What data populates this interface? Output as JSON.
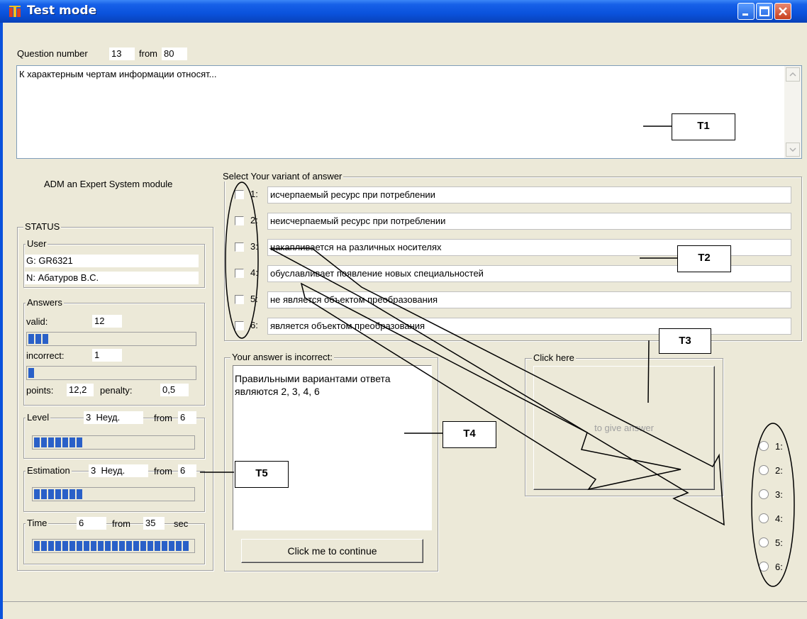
{
  "window": {
    "title": "Test mode",
    "icon": "app-icon"
  },
  "header": {
    "question_label": "Question number",
    "question_number": "13",
    "from_label": "from",
    "total": "80"
  },
  "question": {
    "text": "К характерным чертам информации относят..."
  },
  "module_title": "ADM an Expert System module",
  "status": {
    "title": "STATUS",
    "user": {
      "title": "User",
      "group": "G: GR6321",
      "name": "N: Абатуров В.С."
    },
    "answers": {
      "title": "Answers",
      "valid_label": "valid:",
      "valid_value": "12",
      "valid_progress": 0.12,
      "incorrect_label": "incorrect:",
      "incorrect_value": "1",
      "incorrect_progress": 0.02,
      "points_label": "points:",
      "points_value": "12,2",
      "penalty_label": "penalty:",
      "penalty_value": "0,5"
    },
    "level": {
      "title": "Level",
      "value": "3",
      "grade": "Неуд.",
      "from_label": "from",
      "max": "6",
      "progress": 0.3
    },
    "estimation": {
      "title": "Estimation",
      "value": "3",
      "grade": "Неуд.",
      "from_label": "from",
      "max": "6",
      "progress": 0.3
    },
    "time": {
      "title": "Time",
      "value": "6",
      "from_label": "from",
      "max": "35",
      "unit": "sec",
      "progress": 0.99
    }
  },
  "variants": {
    "title": "Select Your variant of answer",
    "items": [
      {
        "num": "1:",
        "text": "исчерпаемый ресурс при потреблении"
      },
      {
        "num": "2:",
        "text": "неисчерпаемый ресурс при потреблении"
      },
      {
        "num": "3:",
        "text": "накапливается на различных носителях"
      },
      {
        "num": "4:",
        "text": "обуславливает появление новых специальностей"
      },
      {
        "num": "5:",
        "text": "не является объектом преобразования"
      },
      {
        "num": "6:",
        "text": "является объектом преобразования"
      }
    ]
  },
  "result": {
    "title": "Your answer is incorrect:",
    "line1": "Правильными вариантами ответа",
    "line2": "являются 2, 3, 4, 6",
    "continue_label": "Click me to continue"
  },
  "give": {
    "title": "Click here",
    "button_label": "to give answer"
  },
  "radios": [
    "1:",
    "2:",
    "3:",
    "4:",
    "5:",
    "6:"
  ],
  "callouts": {
    "t1": "T1",
    "t2": "T2",
    "t3": "T3",
    "t4": "T4",
    "t5": "T5"
  }
}
